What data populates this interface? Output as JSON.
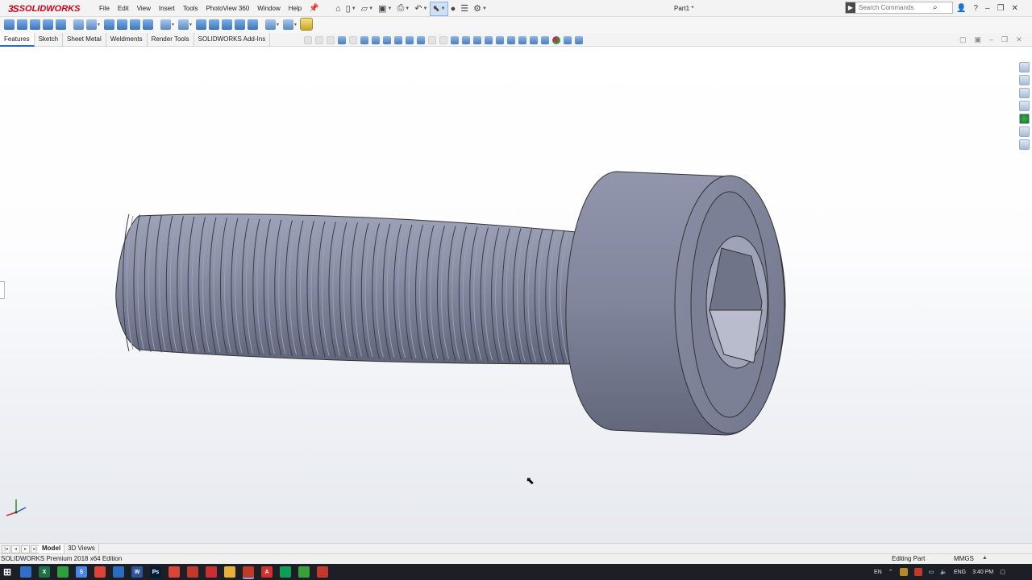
{
  "app": {
    "logo_mark": "3S",
    "logo_text": "SOLIDWORKS",
    "document_title": "Part1 *"
  },
  "menu": [
    "File",
    "Edit",
    "View",
    "Insert",
    "Tools",
    "PhotoView 360",
    "Window",
    "Help"
  ],
  "search": {
    "placeholder": "Search Commands"
  },
  "command_tabs": [
    "Features",
    "Sketch",
    "Sheet Metal",
    "Weldments",
    "Render Tools",
    "SOLIDWORKS Add-Ins"
  ],
  "active_command_tab": "Features",
  "model_tabs": [
    "Model",
    "3D Views"
  ],
  "active_model_tab": "Model",
  "status": {
    "edition": "SOLIDWORKS Premium 2018 x64 Edition",
    "mode": "Editing Part",
    "units": "MMGS",
    "units_dropdown": "▲"
  },
  "tray": {
    "lang": "EN",
    "keyboard": "ENG",
    "time": "3:40 PM"
  },
  "colors": {
    "brand": "#d0021b",
    "accent": "#2a6cc0",
    "model": "#8a8fa8"
  },
  "taskbar_apps": [
    {
      "icon": "windows-icon",
      "label": ""
    },
    {
      "icon": "store-icon",
      "label": ""
    },
    {
      "icon": "excel-icon",
      "label": "X"
    },
    {
      "icon": "camtasia-icon",
      "label": ""
    },
    {
      "icon": "files-icon",
      "label": "S"
    },
    {
      "icon": "chrome-icon",
      "label": ""
    },
    {
      "icon": "screenshot-icon",
      "label": ""
    },
    {
      "icon": "word-icon",
      "label": "W"
    },
    {
      "icon": "photoshop-icon",
      "label": "Ps"
    },
    {
      "icon": "chrome-alt-icon",
      "label": ""
    },
    {
      "icon": "recorder-icon",
      "label": ""
    },
    {
      "icon": "calc-icon",
      "label": ""
    },
    {
      "icon": "folder-icon",
      "label": ""
    },
    {
      "icon": "solidworks-icon",
      "label": ""
    },
    {
      "icon": "acrobat-icon",
      "label": "A"
    },
    {
      "icon": "chrome-2-icon",
      "label": ""
    },
    {
      "icon": "tool-green-icon",
      "label": ""
    },
    {
      "icon": "tool-red-icon",
      "label": ""
    }
  ]
}
